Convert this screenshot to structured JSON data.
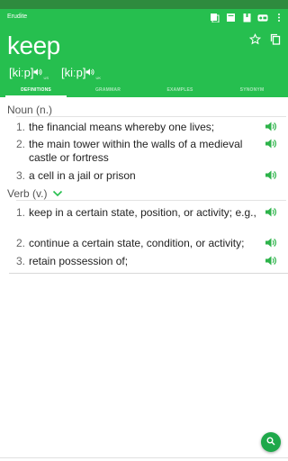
{
  "app": {
    "title": "Erudite"
  },
  "word": "keep",
  "pronunciations": [
    {
      "ipa": "[kiːp]",
      "region": "US"
    },
    {
      "ipa": "[kiːp]",
      "region": "UK"
    }
  ],
  "tabs": [
    {
      "label": "DEFINITIONS",
      "active": true
    },
    {
      "label": "GRAMMAR",
      "active": false
    },
    {
      "label": "EXAMPLES",
      "active": false
    },
    {
      "label": "SYNONYM",
      "active": false
    }
  ],
  "sections": [
    {
      "pos": "Noun (n.)",
      "expanded": false,
      "definitions": [
        {
          "num": "1.",
          "text": "the financial means whereby one lives;"
        },
        {
          "num": "2.",
          "text": "the main tower within the walls of a medieval castle or fortress"
        },
        {
          "num": "3.",
          "text": "a cell in a jail or prison"
        }
      ]
    },
    {
      "pos": "Verb (v.)",
      "expanded": true,
      "definitions": [
        {
          "num": "1.",
          "text": "keep in a certain state, position, or activity; e.g.,"
        },
        {
          "num": "2.",
          "text": "continue a certain state, condition, or activity;"
        },
        {
          "num": "3.",
          "text": "retain possession of;"
        }
      ]
    }
  ],
  "colors": {
    "accent": "#26bf4f",
    "statusbar": "#2e8b3e",
    "speaker": "#2db34a"
  }
}
